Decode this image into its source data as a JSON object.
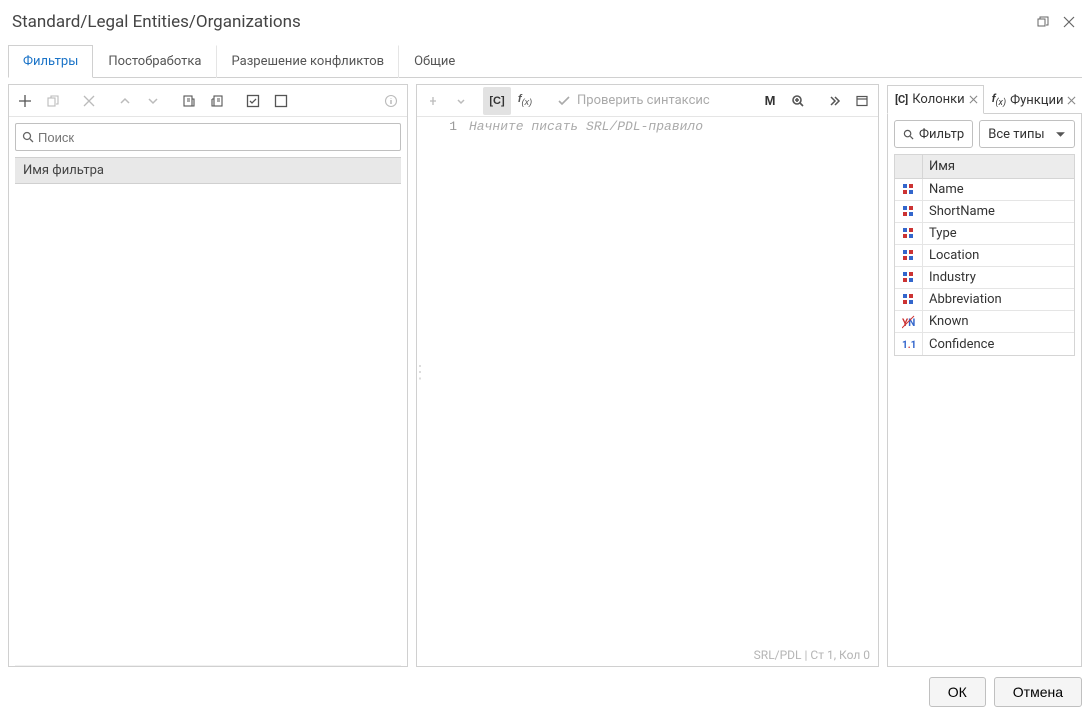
{
  "title": "Standard/Legal Entities/Organizations",
  "tabs": [
    "Фильтры",
    "Постобработка",
    "Разрешение конфликтов",
    "Общие"
  ],
  "active_tab": 0,
  "left": {
    "search_placeholder": "Поиск",
    "grid_header": "Имя фильтра"
  },
  "center": {
    "syntax_check": "Проверить синтаксис",
    "line_no": "1",
    "placeholder": "Начните писать SRL/PDL-правило",
    "status": "SRL/PDL | Ст 1, Кол 0"
  },
  "right": {
    "tabs": [
      {
        "label": "Колонки",
        "icon": "[C]"
      },
      {
        "label": "Функции",
        "icon": "f(x)"
      }
    ],
    "active_tab": 0,
    "filter_label": "Фильтр",
    "types_label": "Все типы",
    "grid_header": "Имя",
    "columns": [
      {
        "name": "Name",
        "type": "enum"
      },
      {
        "name": "ShortName",
        "type": "enum"
      },
      {
        "name": "Type",
        "type": "enum"
      },
      {
        "name": "Location",
        "type": "enum"
      },
      {
        "name": "Industry",
        "type": "enum"
      },
      {
        "name": "Abbreviation",
        "type": "enum"
      },
      {
        "name": "Known",
        "type": "bool"
      },
      {
        "name": "Confidence",
        "type": "num"
      }
    ]
  },
  "footer": {
    "ok": "ОК",
    "cancel": "Отмена"
  }
}
